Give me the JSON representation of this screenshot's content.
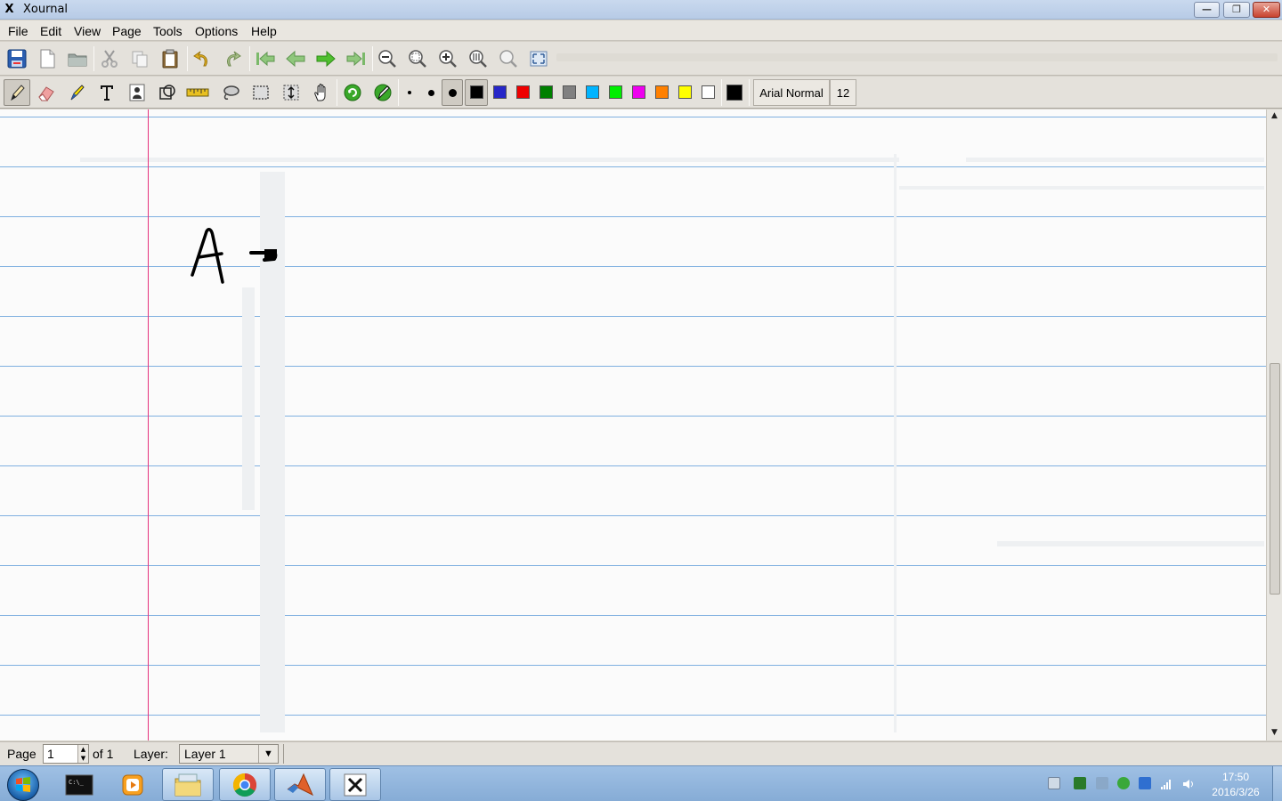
{
  "window": {
    "title": "Xournal",
    "icon_glyph": "X",
    "controls": {
      "minimize": "—",
      "maximize": "❐",
      "close": "✕"
    }
  },
  "menubar": {
    "file": "File",
    "edit": "Edit",
    "view": "View",
    "page": "Page",
    "tools": "Tools",
    "options": "Options",
    "help": "Help"
  },
  "toolbar_icons_main": [
    "save-icon",
    "new-page-icon",
    "open-folder-icon",
    "cut-icon",
    "copy-icon",
    "paste-icon",
    "undo-icon",
    "redo-icon",
    "first-page-icon",
    "previous-page-icon",
    "next-page-icon",
    "last-page-icon",
    "zoom-out-icon",
    "zoom-fit-icon",
    "zoom-in-icon",
    "zoom-100-icon",
    "zoom-height-icon",
    "fullscreen-icon"
  ],
  "toolbar_icons_tools": [
    "pen-icon",
    "eraser-icon",
    "highlighter-icon",
    "text-icon",
    "image-icon",
    "shape-recognizer-icon",
    "ruler-icon",
    "lasso-select-icon",
    "rect-select-icon",
    "vertical-space-icon",
    "hand-icon",
    "default-tool-icon",
    "default-pen-icon"
  ],
  "pen_sizes": [
    "fine",
    "medium",
    "thick"
  ],
  "colors": {
    "black": "#000000",
    "blue": "#2626c8",
    "red": "#ee0000",
    "green": "#008000",
    "gray": "#808080",
    "light_blue": "#00b4ff",
    "light_green": "#00ee00",
    "magenta": "#ee00ee",
    "orange": "#ff8000",
    "yellow": "#ffff00",
    "white": "#ffffff",
    "current": "#000000"
  },
  "font_button": {
    "font": "Arial Normal",
    "size": "12"
  },
  "document": {
    "handwriting": "A",
    "ruling_color": "#7fb0e0",
    "margin_color": "#e5337d"
  },
  "statusbar": {
    "page_label": "Page",
    "page_value": "1",
    "page_total": "of 1",
    "layer_label": "Layer:",
    "layer_value": "Layer 1"
  },
  "taskbar": {
    "apps": [
      "terminal-icon",
      "media-player-icon",
      "file-explorer-icon",
      "chrome-icon",
      "matlab-icon",
      "xournal-icon"
    ],
    "clock_time": "17:50",
    "clock_date": "2016/3/26"
  }
}
